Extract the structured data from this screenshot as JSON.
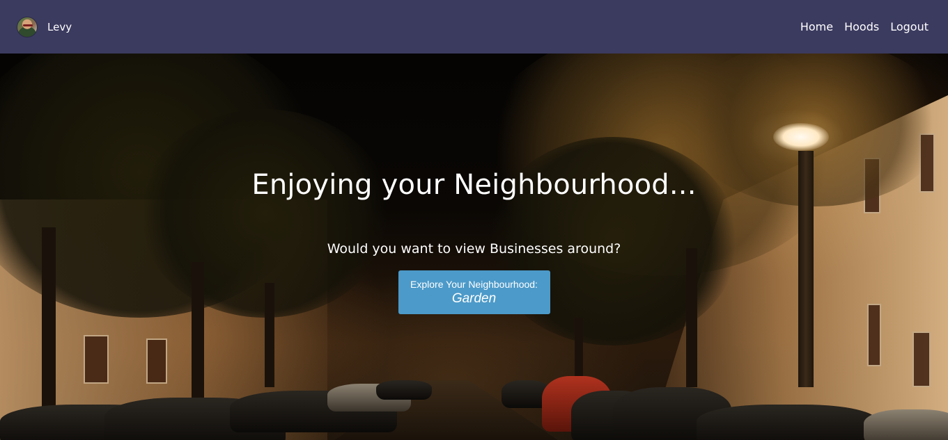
{
  "navbar": {
    "user_name": "Levy",
    "links": [
      {
        "label": "Home"
      },
      {
        "label": "Hoods"
      },
      {
        "label": "Logout"
      }
    ]
  },
  "hero": {
    "title": "Enjoying your Neighbourhood...",
    "subtitle": "Would you want to view Businesses around?",
    "explore_button": {
      "label": "Explore Your Neighbourhood:",
      "neighbourhood": "Garden"
    },
    "background_description_icon": "night-street-photo"
  },
  "colors": {
    "navbar_bg": "#3b3a5f",
    "button_bg": "#4c9ac9",
    "text": "#ffffff"
  }
}
